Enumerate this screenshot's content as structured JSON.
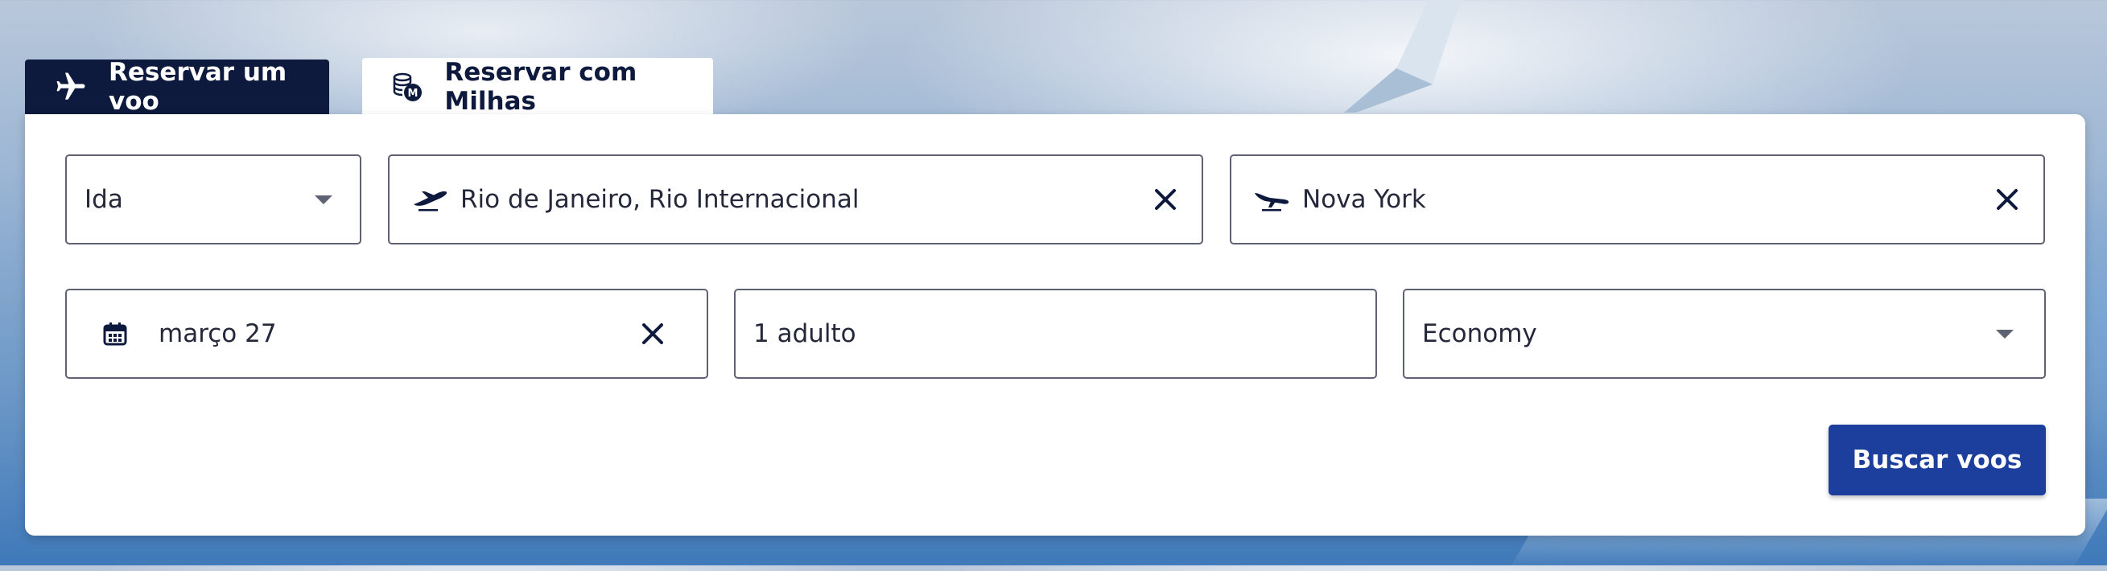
{
  "tabs": [
    {
      "label": "Reservar um voo",
      "icon": "airplane-icon",
      "active": false
    },
    {
      "label": "Reservar com Milhas",
      "icon": "miles-coins-icon",
      "active": true
    }
  ],
  "form": {
    "trip_type": {
      "value": "Ida",
      "icon": "chevron-down-icon"
    },
    "origin": {
      "value": "Rio de Janeiro, Rio Internacional",
      "icon": "plane-takeoff-icon"
    },
    "destination": {
      "value": "Nova York",
      "icon": "plane-landing-icon"
    },
    "date": {
      "value": "março 27",
      "icon": "calendar-icon"
    },
    "passengers": {
      "value": "1 adulto"
    },
    "cabin_class": {
      "value": "Economy",
      "icon": "chevron-down-icon"
    },
    "search_label": "Buscar voos"
  },
  "colors": {
    "navy": "#0e1a3d",
    "button_blue": "#1c3f9e",
    "border": "#5e6272"
  }
}
